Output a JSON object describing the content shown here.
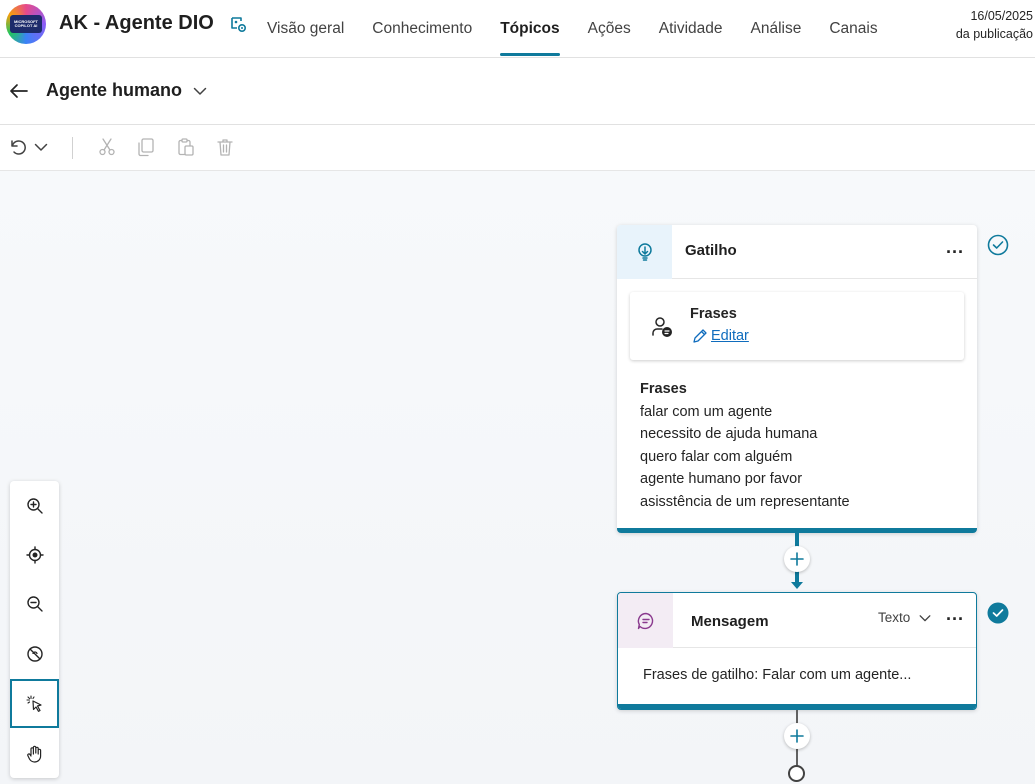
{
  "app": {
    "title": "AK - Agente DIO",
    "logo_text": "MICROSOFT COPILOT AI"
  },
  "nav": {
    "tabs": [
      {
        "label": "Visão geral",
        "active": false
      },
      {
        "label": "Conhecimento",
        "active": false
      },
      {
        "label": "Tópicos",
        "active": true
      },
      {
        "label": "Ações",
        "active": false
      },
      {
        "label": "Atividade",
        "active": false
      },
      {
        "label": "Análise",
        "active": false
      },
      {
        "label": "Canais",
        "active": false
      }
    ]
  },
  "publish": {
    "date": "16/05/2025",
    "label": "da publicação"
  },
  "topic": {
    "name": "Agente humano"
  },
  "toolbar": {
    "icons": [
      "undo-icon",
      "chevron-down-icon",
      "cut-icon",
      "copy-icon",
      "paste-icon",
      "delete-icon"
    ]
  },
  "trigger_card": {
    "title": "Gatilho",
    "inner_title": "Frases",
    "edit_label": "Editar",
    "phrases_title": "Frases",
    "phrases": [
      "falar com um agente",
      "necessito de ajuda humana",
      "quero falar com alguém",
      "agente humano por favor",
      "asisstência de um representante"
    ]
  },
  "message_card": {
    "title": "Mensagem",
    "type_label": "Texto",
    "preview": "Frases de gatilho: Falar com um agente..."
  },
  "zoom": {
    "buttons": [
      "zoom-in-icon",
      "recenter-icon",
      "zoom-out-icon",
      "minimap-toggle-icon",
      "select-pointer-icon",
      "pan-hand-icon"
    ]
  },
  "colors": {
    "accent": "#0f7a9c",
    "link": "#0f6cbd",
    "trigger_icon_bg": "#e8f3fb",
    "message_icon_bg": "#f3ecf4"
  }
}
